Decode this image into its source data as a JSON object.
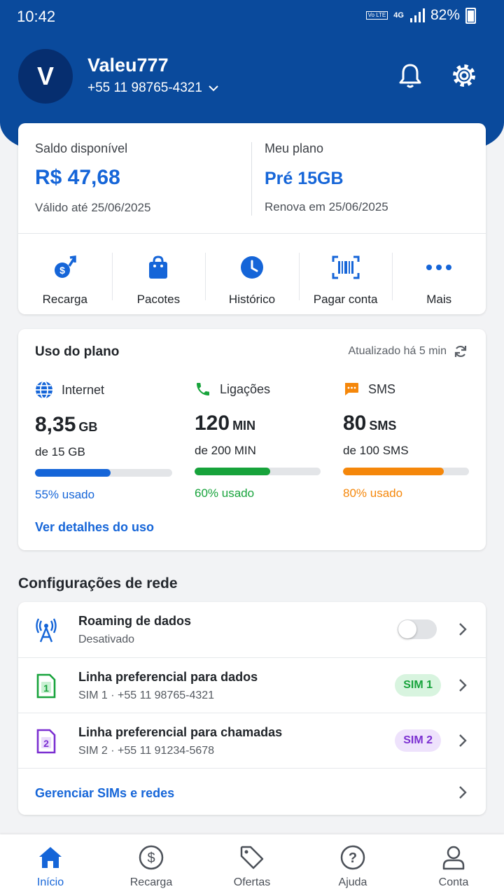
{
  "status_bar": {
    "time": "10:42",
    "volte": "Vo LTE",
    "network": "4G",
    "battery": "82%"
  },
  "header": {
    "avatar_initial": "V",
    "username": "Valeu777",
    "phone": "+55 11 98765-4321"
  },
  "balance": {
    "label": "Saldo disponível",
    "value": "R$ 47,68",
    "valid_until": "Válido até 25/06/2025",
    "plan_label": "Meu plano",
    "plan_value": "Pré 15GB",
    "plan_renew": "Renova em 25/06/2025"
  },
  "actions": [
    {
      "label": "Recarga",
      "icon": "recharge-icon"
    },
    {
      "label": "Pacotes",
      "icon": "bag-icon"
    },
    {
      "label": "Histórico",
      "icon": "clock-icon"
    },
    {
      "label": "Pagar conta",
      "icon": "barcode-icon"
    },
    {
      "label": "Mais",
      "icon": "more-icon"
    }
  ],
  "usage": {
    "title": "Uso do plano",
    "updated": "Atualizado há 5 min",
    "link": "Ver detalhes do uso",
    "items": [
      {
        "name": "Internet",
        "value": "8,35",
        "unit": "GB",
        "total": "de 15 GB",
        "percent_label": "55% usado",
        "percent": 55,
        "color": "#1565d8"
      },
      {
        "name": "Ligações",
        "value": "120",
        "unit": "MIN",
        "total": "de 200 MIN",
        "percent_label": "60% usado",
        "percent": 60,
        "color": "#17a33b"
      },
      {
        "name": "SMS",
        "value": "80",
        "unit": "SMS",
        "total": "de 100 SMS",
        "percent_label": "80% usado",
        "percent": 80,
        "color": "#f5870a"
      }
    ]
  },
  "network": {
    "section_title": "Configurações de rede",
    "roaming": {
      "title": "Roaming de dados",
      "subtitle": "Desativado",
      "enabled": false
    },
    "data_line": {
      "title": "Linha preferencial para dados",
      "sim": "SIM 1",
      "number": "+55 11 98765-4321",
      "badge": "SIM 1"
    },
    "call_line": {
      "title": "Linha preferencial para chamadas",
      "sim": "SIM 2",
      "number": "+55 11 91234-5678",
      "badge": "SIM 2"
    },
    "manage_link": "Gerenciar SIMs e redes"
  },
  "bottom_nav": [
    {
      "label": "Início",
      "icon": "home-icon",
      "active": true
    },
    {
      "label": "Recarga",
      "icon": "dollar-icon"
    },
    {
      "label": "Ofertas",
      "icon": "tag-icon"
    },
    {
      "label": "Ajuda",
      "icon": "help-icon"
    },
    {
      "label": "Conta",
      "icon": "user-icon"
    }
  ],
  "colors": {
    "header": "#0a4a9c",
    "accent": "#1565d8",
    "green": "#17a33b",
    "orange": "#f5870a",
    "purple": "#7b2fd1"
  }
}
